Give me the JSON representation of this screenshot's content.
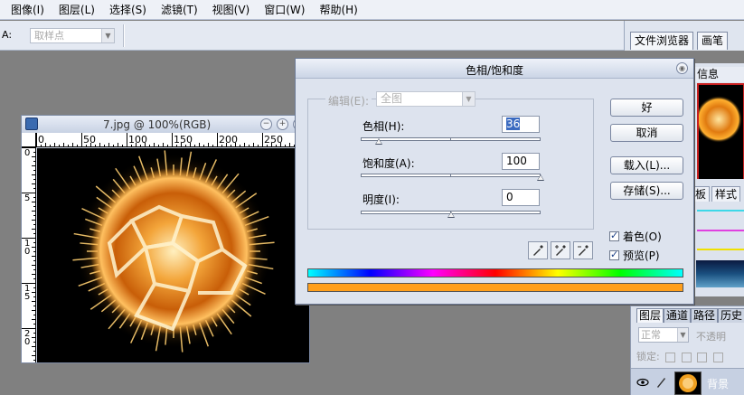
{
  "menu": [
    "图像(I)",
    "图层(L)",
    "选择(S)",
    "滤镜(T)",
    "视图(V)",
    "窗口(W)",
    "帮助(H)"
  ],
  "options_bar": {
    "label": "A:",
    "sample_select": "取样点"
  },
  "palette_well": {
    "tabs": [
      "文件浏览器",
      "画笔"
    ]
  },
  "navigator": {
    "tab": "信息"
  },
  "swatches": {
    "tabs": [
      "板",
      "样式"
    ]
  },
  "layers": {
    "tabs": [
      "图层",
      "通道",
      "路径",
      "历史"
    ],
    "blend_mode": "正常",
    "opacity_label": "不透明",
    "lock_label": "锁定:",
    "layer_name": "背景"
  },
  "document": {
    "title": "7.jpg @ 100%(RGB)",
    "ruler_top": [
      "0",
      "50",
      "100",
      "150",
      "200",
      "250"
    ],
    "ruler_left": [
      "0",
      "5",
      "10",
      "15",
      "20"
    ]
  },
  "dialog": {
    "title": "色相/饱和度",
    "edit_label": "编辑(E):",
    "edit_value": "全图",
    "hue": {
      "label": "色相(H):",
      "value": "36",
      "position": 0.1
    },
    "saturation": {
      "label": "饱和度(A):",
      "value": "100",
      "position": 1.0
    },
    "lightness": {
      "label": "明度(I):",
      "value": "0",
      "position": 0.5
    },
    "buttons": {
      "ok": "好",
      "cancel": "取消",
      "load": "载入(L)...",
      "save": "存储(S)..."
    },
    "colorize": {
      "label": "着色(O)",
      "checked": true
    },
    "preview": {
      "label": "预览(P)",
      "checked": true
    },
    "output_color": "#ff9f1c"
  },
  "icons": [
    "close-icon",
    "eyedropper-icon",
    "eyedropper-plus-icon",
    "eyedropper-minus-icon",
    "eye-icon",
    "brush-icon",
    "photoshop-doc-icon"
  ]
}
